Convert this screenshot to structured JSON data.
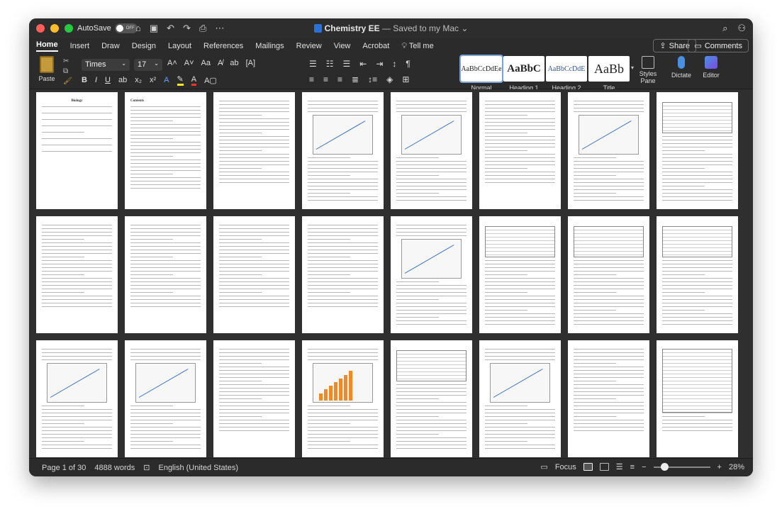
{
  "titlebar": {
    "autosave_label": "AutoSave",
    "autosave_state": "OFF",
    "doc_name": "Chemistry EE",
    "saved_status": " — Saved to my Mac ⌄"
  },
  "tabs": [
    "Home",
    "Insert",
    "Draw",
    "Design",
    "Layout",
    "References",
    "Mailings",
    "Review",
    "View",
    "Acrobat",
    "Tell me"
  ],
  "share_label": "Share",
  "comments_label": "Comments",
  "ribbon": {
    "paste_label": "Paste",
    "font_name": "Times",
    "font_size": "17",
    "styles": [
      {
        "sample": "AaBbCcDdEe",
        "name": "Normal"
      },
      {
        "sample": "AaBbC",
        "name": "Heading 1"
      },
      {
        "sample": "AaBbCcDdE",
        "name": "Heading 2"
      },
      {
        "sample": "AaBb",
        "name": "Title"
      }
    ],
    "styles_pane_label": "Styles Pane",
    "dictate_label": "Dictate",
    "editor_label": "Editor"
  },
  "pages": {
    "p1_title": "Biology",
    "p2_title": "Contents"
  },
  "status": {
    "page_info": "Page 1 of 30",
    "word_count": "4888 words",
    "language": "English (United States)",
    "focus_label": "Focus",
    "zoom": "28%"
  },
  "chart_pages": {
    "bar_values": [
      4,
      6,
      8,
      10,
      12,
      14,
      16
    ]
  }
}
